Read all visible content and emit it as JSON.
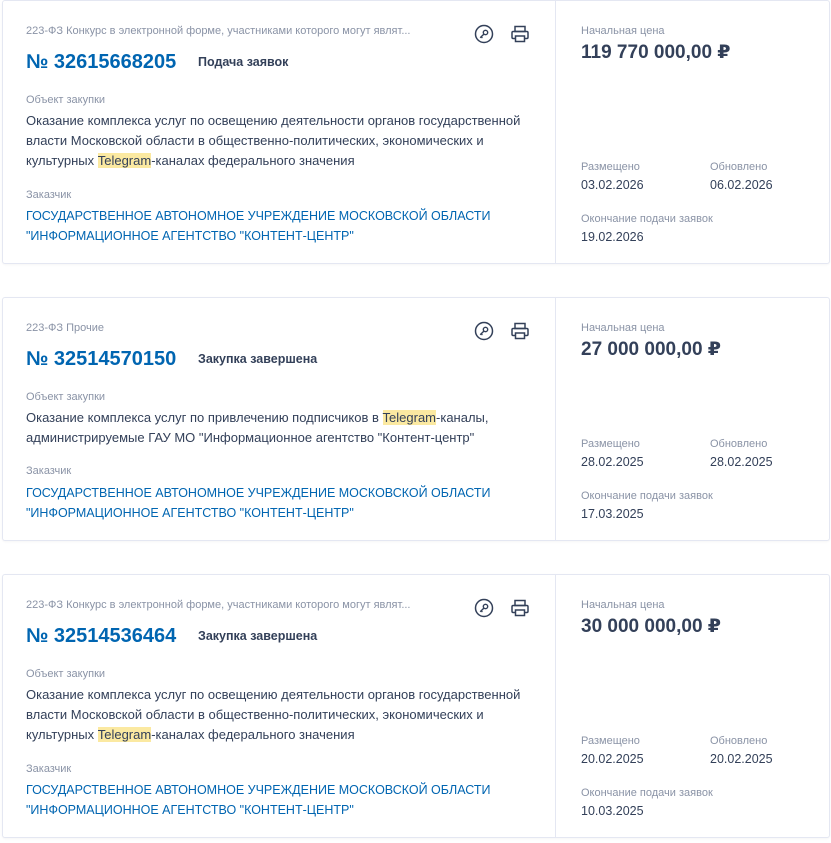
{
  "cards": [
    {
      "law": "223-ФЗ Конкурс в электронной форме, участниками которого могут являт...",
      "reg_number": "№ 32615668205",
      "status": "Подача заявок",
      "object_label": "Объект закупки",
      "object_before": "Оказание комплекса услуг по освещению деятельности органов государственной власти Московской области в общественно-политических, экономических и культурных ",
      "object_highlight": "Telegram",
      "object_after": "-каналах федерального значения",
      "customer_label": "Заказчик",
      "customer": "ГОСУДАРСТВЕННОЕ АВТОНОМНОЕ УЧРЕЖДЕНИЕ МОСКОВСКОЙ ОБЛАСТИ \"ИНФОРМАЦИОННОЕ АГЕНТСТВО \"КОНТЕНТ-ЦЕНТР\"",
      "price_label": "Начальная цена",
      "price": "119 770 000,00 ₽",
      "posted_label": "Размещено",
      "posted": "03.02.2026",
      "updated_label": "Обновлено",
      "updated": "06.02.2026",
      "deadline_label": "Окончание подачи заявок",
      "deadline": "19.02.2026"
    },
    {
      "law": "223-ФЗ Прочие",
      "reg_number": "№ 32514570150",
      "status": "Закупка завершена",
      "object_label": "Объект закупки",
      "object_before": "Оказание комплекса услуг по привлечению подписчиков в ",
      "object_highlight": "Telegram",
      "object_after": "-каналы, администрируемые ГАУ МО \"Информационное агентство \"Контент-центр\"",
      "customer_label": "Заказчик",
      "customer": "ГОСУДАРСТВЕННОЕ АВТОНОМНОЕ УЧРЕЖДЕНИЕ МОСКОВСКОЙ ОБЛАСТИ \"ИНФОРМАЦИОННОЕ АГЕНТСТВО \"КОНТЕНТ-ЦЕНТР\"",
      "price_label": "Начальная цена",
      "price": "27 000 000,00 ₽",
      "posted_label": "Размещено",
      "posted": "28.02.2025",
      "updated_label": "Обновлено",
      "updated": "28.02.2025",
      "deadline_label": "Окончание подачи заявок",
      "deadline": "17.03.2025"
    },
    {
      "law": "223-ФЗ Конкурс в электронной форме, участниками которого могут являт...",
      "reg_number": "№ 32514536464",
      "status": "Закупка завершена",
      "object_label": "Объект закупки",
      "object_before": "Оказание комплекса услуг по освещению деятельности органов государственной власти Московской области в общественно-политических, экономических и культурных ",
      "object_highlight": "Telegram",
      "object_after": "-каналах федерального значения",
      "customer_label": "Заказчик",
      "customer": "ГОСУДАРСТВЕННОЕ АВТОНОМНОЕ УЧРЕЖДЕНИЕ МОСКОВСКОЙ ОБЛАСТИ \"ИНФОРМАЦИОННОЕ АГЕНТСТВО \"КОНТЕНТ-ЦЕНТР\"",
      "price_label": "Начальная цена",
      "price": "30 000 000,00 ₽",
      "posted_label": "Размещено",
      "posted": "20.02.2025",
      "updated_label": "Обновлено",
      "updated": "20.02.2025",
      "deadline_label": "Окончание подачи заявок",
      "deadline": "10.03.2025"
    }
  ],
  "icons": {
    "key": "key-icon",
    "print": "printer-icon"
  },
  "colors": {
    "link": "#0065b1",
    "highlight": "#fbe9a1",
    "muted": "#8a93a6",
    "text": "#334059"
  }
}
